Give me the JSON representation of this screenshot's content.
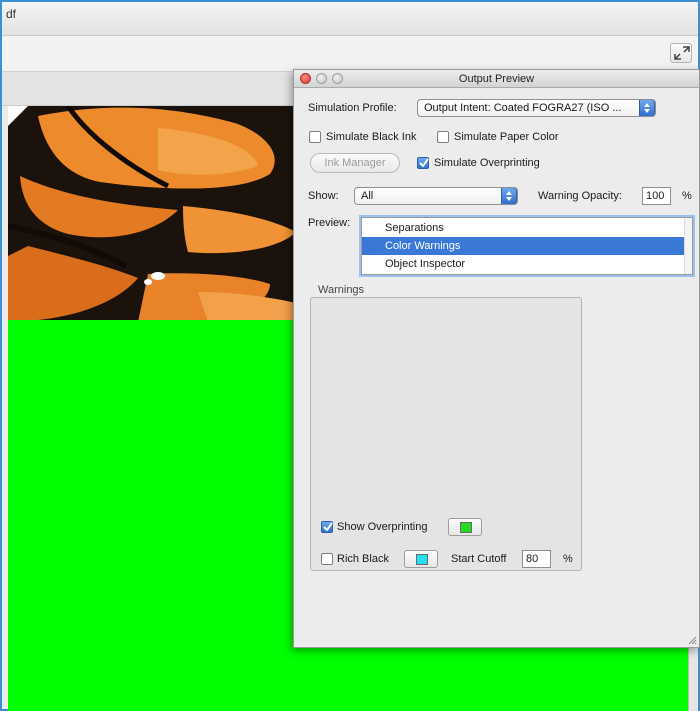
{
  "app": {
    "title": "df"
  },
  "panel": {
    "title": "Output Preview",
    "simulation_profile_label": "Simulation Profile:",
    "simulation_profile_value": "Output Intent: Coated FOGRA27 (ISO ...",
    "simulate_black_ink_label": "Simulate Black Ink",
    "simulate_black_ink_checked": false,
    "simulate_paper_color_label": "Simulate Paper Color",
    "simulate_paper_color_checked": false,
    "ink_manager_label": "Ink Manager",
    "simulate_overprinting_label": "Simulate Overprinting",
    "simulate_overprinting_checked": true,
    "show_label": "Show:",
    "show_value": "All",
    "warning_opacity_label": "Warning Opacity:",
    "warning_opacity_value": "100",
    "warning_opacity_unit": "%",
    "preview_label": "Preview:",
    "preview_items": [
      "Separations",
      "Color Warnings",
      "Object Inspector"
    ],
    "preview_selected": "Color Warnings",
    "warnings_group_label": "Warnings",
    "show_overprinting_label": "Show Overprinting",
    "show_overprinting_checked": true,
    "show_overprinting_color": "#22dd22",
    "rich_black_label": "Rich Black",
    "rich_black_checked": false,
    "rich_black_color": "#22e0f0",
    "start_cutoff_label": "Start Cutoff",
    "start_cutoff_value": "80",
    "start_cutoff_unit": "%"
  },
  "colors": {
    "canvas_green": "#00ff00",
    "selection_blue": "#3a78d8",
    "window_border": "#3c8fd0"
  },
  "icons": {
    "expand": "expand-icon",
    "close": "close-window-icon",
    "minimize": "minimize-window-icon",
    "zoom": "zoom-window-icon",
    "popup_arrows": "popup-arrows-icon",
    "checkmark": "checkmark-icon",
    "resize": "resize-grip-icon"
  }
}
